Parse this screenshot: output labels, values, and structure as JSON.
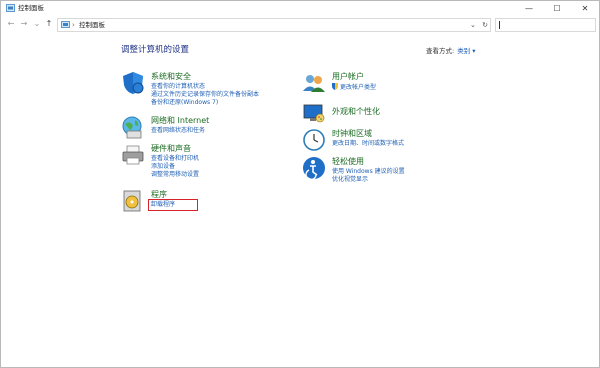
{
  "window": {
    "title": "控制面板"
  },
  "address": {
    "path": "控制面板",
    "search_placeholder": ""
  },
  "main": {
    "title": "调整计算机的设置",
    "view_by_label": "查看方式:",
    "view_by_value": "类别 ▾"
  },
  "left_categories": [
    {
      "title": "系统和安全",
      "links": [
        "查看你的计算机状态",
        "通过文件历史记录保存你的文件备份副本",
        "备份和还原(Windows 7)"
      ]
    },
    {
      "title": "网络和 Internet",
      "links": [
        "查看网络状态和任务"
      ]
    },
    {
      "title": "硬件和声音",
      "links": [
        "查看设备和打印机",
        "添加设备",
        "调整常用移动设置"
      ]
    },
    {
      "title": "程序",
      "links": [
        "卸载程序"
      ]
    }
  ],
  "right_categories": [
    {
      "title": "用户帐户",
      "links": [
        "更改帐户类型"
      ]
    },
    {
      "title": "外观和个性化",
      "links": []
    },
    {
      "title": "时钟和区域",
      "links": [
        "更改日期、时间或数字格式"
      ]
    },
    {
      "title": "轻松使用",
      "links": [
        "使用 Windows 建议的设置",
        "优化视觉显示"
      ]
    }
  ],
  "colors": {
    "link": "#1f5fb4",
    "category_title": "#1b6b22",
    "highlight": "#d9232a",
    "page_title": "#1e3287"
  },
  "icons": {
    "titlebar": "control-panel-icon",
    "back": "back-arrow-icon",
    "forward": "forward-arrow-icon",
    "recent": "chevron-down-icon",
    "up": "up-arrow-icon",
    "refresh": "refresh-icon"
  },
  "window_controls": {
    "minimize": "—",
    "maximize": "☐",
    "close": "✕"
  },
  "nav_glyphs": {
    "back": "←",
    "forward": "→",
    "recent": "⌄",
    "up": "↑",
    "sep": "›",
    "dropdown": "⌄",
    "refresh": "↻"
  }
}
